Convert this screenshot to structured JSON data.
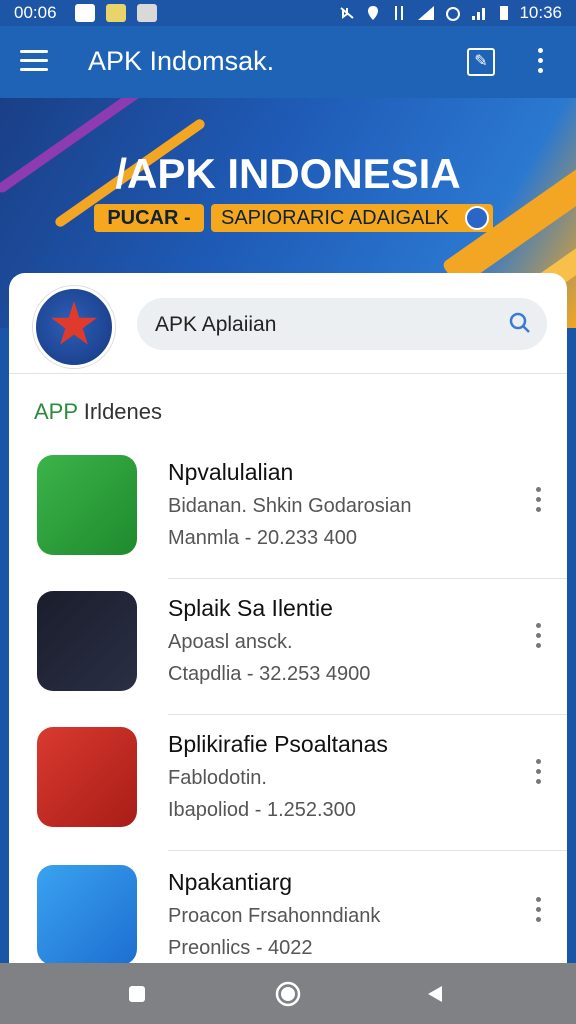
{
  "status": {
    "time_left": "00:06",
    "time_right": "10:36"
  },
  "appbar": {
    "title": "APK Indomsak.",
    "menu_icon": "hamburger-menu-icon",
    "edit_icon": "edit-icon",
    "more_icon": "more-vert-icon"
  },
  "banner": {
    "title": "/APK INDONESIA",
    "tag1": "PUCAR -",
    "tag2": "SAPIORARIC ADAIGALK"
  },
  "search": {
    "value": "APK Aplaiian"
  },
  "section": {
    "title_part1": "APP",
    "title_part2": " Irldenes"
  },
  "apps": [
    {
      "name": "Npvalulalian",
      "sub": "Bidanan. Shkin Godarosian",
      "meta": "Manmla - 20.233 400",
      "icon_color": "#2e9d3a"
    },
    {
      "name": "Splaik Sa Ilentie",
      "sub": "Apoasl ansck.",
      "meta": "Ctapdlia - 32.253 4900",
      "icon_color": "#1a1d2b"
    },
    {
      "name": "Bplikirafie Psoaltanas",
      "sub": "Fablodotin.",
      "meta": "Ibapoliod - 1.252.300",
      "icon_color": "#c62a22"
    },
    {
      "name": "Npakantiarg",
      "sub": "Proacon Frsahonndiank",
      "meta": "Preonlics - 4022",
      "icon_color": "#2a8ae0"
    }
  ],
  "colors": {
    "appbar": "#1e63b5",
    "accent_green": "#2e8b3e",
    "banner_orange": "#f5a81e"
  }
}
